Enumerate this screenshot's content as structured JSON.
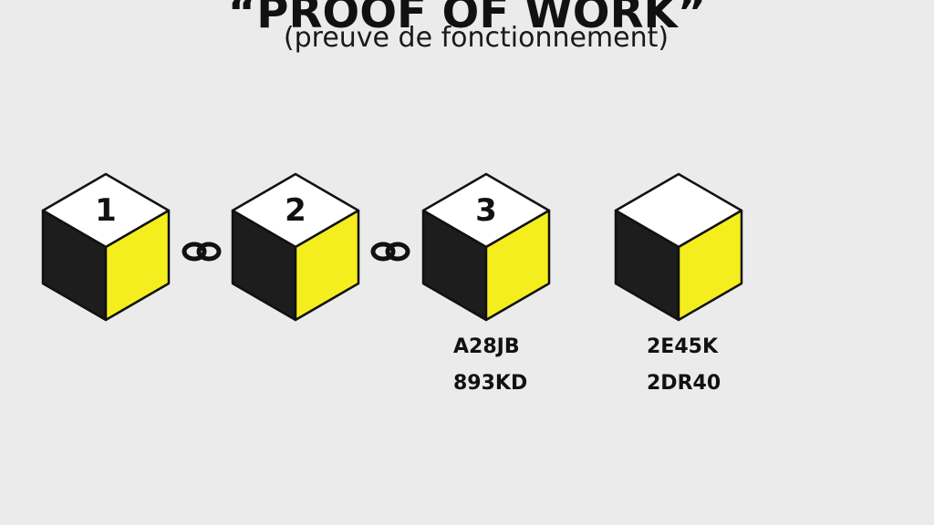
{
  "title": "“PROOF OF WORK”",
  "subtitle": "(preuve de fonctionnement)",
  "colors": {
    "background": "#ebebeb",
    "cube_top": "#ffffff",
    "cube_left": "#1d1d1d",
    "cube_right": "#f5ee1f",
    "outline": "#111111"
  },
  "blocks": [
    {
      "number": "1",
      "hash_lines": []
    },
    {
      "number": "2",
      "hash_lines": []
    },
    {
      "number": "3",
      "hash_lines": [
        "A28JB",
        "893KD"
      ]
    },
    {
      "number": "",
      "hash_lines": [
        "2E45K",
        "2DR40"
      ]
    }
  ],
  "links": [
    {
      "icon": "chain-link-icon"
    },
    {
      "icon": "chain-link-icon"
    }
  ]
}
